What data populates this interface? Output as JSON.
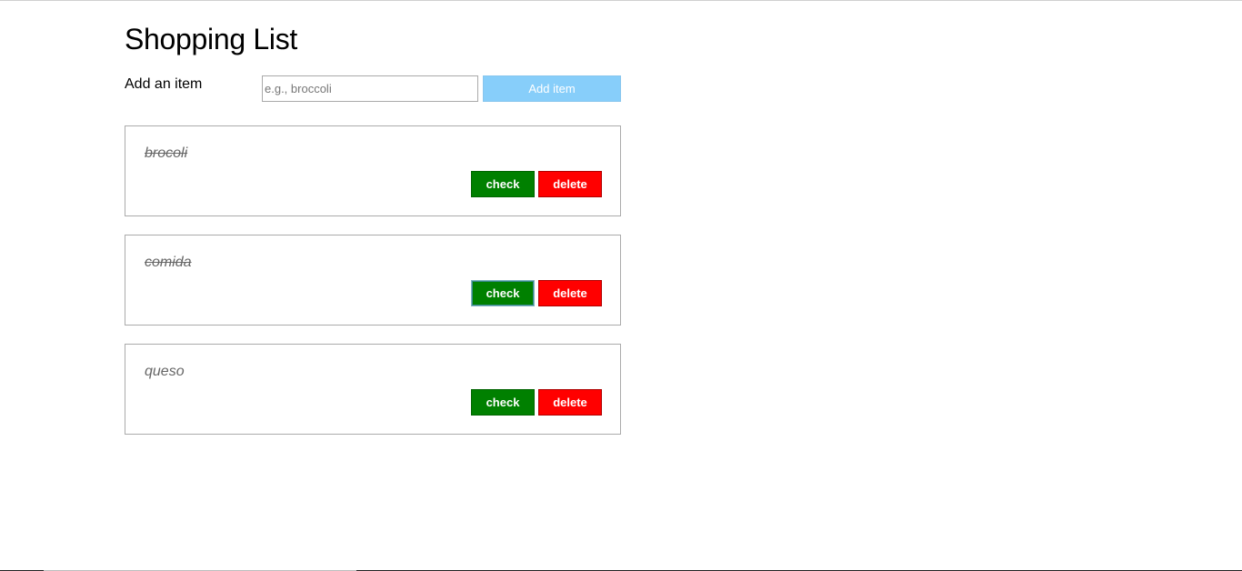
{
  "page": {
    "title": "Shopping List"
  },
  "add_form": {
    "label": "Add an item",
    "input_value": "",
    "input_placeholder": "e.g., broccoli",
    "button_label": "Add item"
  },
  "items": [
    {
      "name": "brocoli",
      "checked": true,
      "check_label": "check",
      "delete_label": "delete",
      "check_focused": false
    },
    {
      "name": "comida",
      "checked": true,
      "check_label": "check",
      "delete_label": "delete",
      "check_focused": true
    },
    {
      "name": "queso",
      "checked": false,
      "check_label": "check",
      "delete_label": "delete",
      "check_focused": false
    }
  ],
  "colors": {
    "check_button": "#008000",
    "delete_button": "#ff0000",
    "add_button": "#87cefa"
  }
}
